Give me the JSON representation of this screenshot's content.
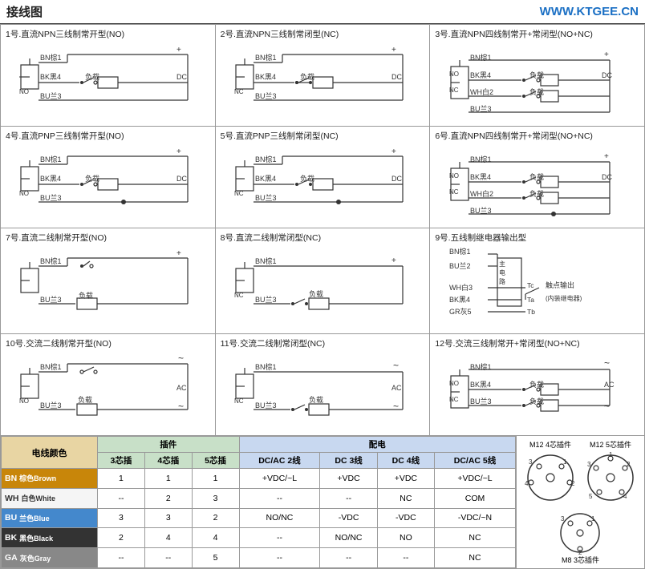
{
  "header": {
    "title": "接线图",
    "url": "WWW.KTGEE.CN"
  },
  "diagrams": [
    {
      "id": 1,
      "title": "1号.直流NPN三线制常开型(NO)",
      "type": "NPN3NO"
    },
    {
      "id": 2,
      "title": "2号.直流NPN三线制常闭型(NC)",
      "type": "NPN3NC"
    },
    {
      "id": 3,
      "title": "3号.直流NPN四线制常开+常闭型(NO+NC)",
      "type": "NPN4"
    },
    {
      "id": 4,
      "title": "4号.直流PNP三线制常开型(NO)",
      "type": "PNP3NO"
    },
    {
      "id": 5,
      "title": "5号.直流PNP三线制常闭型(NC)",
      "type": "PNP3NC"
    },
    {
      "id": 6,
      "title": "6号.直流NPN四线制常开+常闭型(NO+NC)",
      "type": "PNP4"
    },
    {
      "id": 7,
      "title": "7号.直流二线制常开型(NO)",
      "type": "2WIRENO"
    },
    {
      "id": 8,
      "title": "8号.直流二线制常闭型(NC)",
      "type": "2WIRENC"
    },
    {
      "id": 9,
      "title": "9号.五线制继电器输出型",
      "type": "RELAY5"
    },
    {
      "id": 10,
      "title": "10号.交流二线制常开型(NO)",
      "type": "AC2WIRENO"
    },
    {
      "id": 11,
      "title": "11号.交流二线制常闭型(NC)",
      "type": "AC2WIRENC"
    },
    {
      "id": 12,
      "title": "12号.交流三线制常开+常闭型(NO+NC)",
      "type": "AC3WIRE"
    }
  ],
  "color_table": {
    "section1_label": "电线颜色",
    "section2_label": "插件",
    "section3_label": "配电",
    "plug_cols": [
      "3芯插",
      "4芯插",
      "5芯插"
    ],
    "power_cols": [
      "DC/AC 2线",
      "DC 3线",
      "DC 4线",
      "DC/AC 5线"
    ],
    "rows": [
      {
        "code": "BN",
        "cn": "棕色",
        "en": "Brown",
        "color": "#c8860a",
        "plug": [
          1,
          1,
          1
        ],
        "power": [
          "+VDC/~L",
          "+VDC",
          "+VDC",
          "+VDC/~L"
        ]
      },
      {
        "code": "WH",
        "cn": "白色",
        "en": "White",
        "color": "#ffffff",
        "plug": [
          "--",
          2,
          3
        ],
        "power": [
          "--",
          "--",
          "NC",
          "COM"
        ]
      },
      {
        "code": "BU",
        "cn": "蓝色",
        "en": "Blue",
        "color": "#4488cc",
        "plug": [
          3,
          3,
          2
        ],
        "power": [
          "NO/NC",
          "-VDC",
          "-VDC",
          "-VDC/~N"
        ]
      },
      {
        "code": "BK",
        "cn": "黑色",
        "en": "Black",
        "color": "#333333",
        "plug": [
          2,
          4,
          4
        ],
        "power": [
          "--",
          "NO/NC",
          "NO",
          "NC"
        ]
      },
      {
        "code": "GA",
        "cn": "灰色",
        "en": "Gray",
        "color": "#888888",
        "plug": [
          "--",
          "--",
          5
        ],
        "power": [
          "--",
          "--",
          "--",
          "NC"
        ]
      }
    ]
  },
  "m12": {
    "label4": "M12 4芯插件",
    "label5": "M12 5芯插件",
    "label_m8": "M8 3芯插件"
  }
}
